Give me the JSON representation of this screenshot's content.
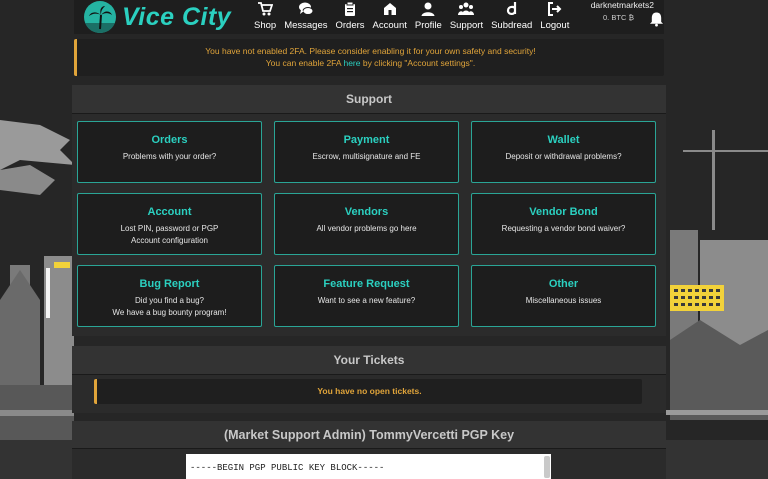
{
  "header": {
    "logo_text": "Vice City",
    "nav": [
      {
        "label": "Shop",
        "icon": "cart-icon"
      },
      {
        "label": "Messages",
        "icon": "messages-icon"
      },
      {
        "label": "Orders",
        "icon": "orders-icon"
      },
      {
        "label": "Account",
        "icon": "account-icon"
      },
      {
        "label": "Profile",
        "icon": "profile-icon"
      },
      {
        "label": "Support",
        "icon": "support-icon"
      },
      {
        "label": "Subdread",
        "icon": "subdread-icon"
      },
      {
        "label": "Logout",
        "icon": "logout-icon"
      }
    ],
    "username": "darknetmarkets2",
    "balance": "0. BTC ₿"
  },
  "alert": {
    "line1": "You have not enabled 2FA. Please consider enabling it for your own safety and security!",
    "line2_prefix": "You can enable 2FA ",
    "line2_link": "here",
    "line2_suffix": " by clicking \"Account settings\"."
  },
  "support": {
    "title": "Support",
    "cards": [
      {
        "title": "Orders",
        "desc": "Problems with your order?"
      },
      {
        "title": "Payment",
        "desc": "Escrow, multisignature and FE"
      },
      {
        "title": "Wallet",
        "desc": "Deposit or withdrawal problems?"
      },
      {
        "title": "Account",
        "desc": "Lost PIN, password or PGP\nAccount configuration"
      },
      {
        "title": "Vendors",
        "desc": "All vendor problems go here"
      },
      {
        "title": "Vendor Bond",
        "desc": "Requesting a vendor bond waiver?"
      },
      {
        "title": "Bug Report",
        "desc": "Did you find a bug?\nWe have a bug bounty program!"
      },
      {
        "title": "Feature Request",
        "desc": "Want to see a new feature?"
      },
      {
        "title": "Other",
        "desc": "Miscellaneous issues"
      }
    ]
  },
  "tickets": {
    "title": "Your Tickets",
    "empty_text": "You have no open tickets."
  },
  "pgp": {
    "title": "(Market Support Admin) TommyVercetti PGP Key",
    "key_first_line": "-----BEGIN PGP PUBLIC KEY BLOCK-----"
  },
  "colors": {
    "accent": "#2bd0c0",
    "warning": "#e0a43a",
    "panel": "#2b2b2b",
    "background": "#262626"
  }
}
